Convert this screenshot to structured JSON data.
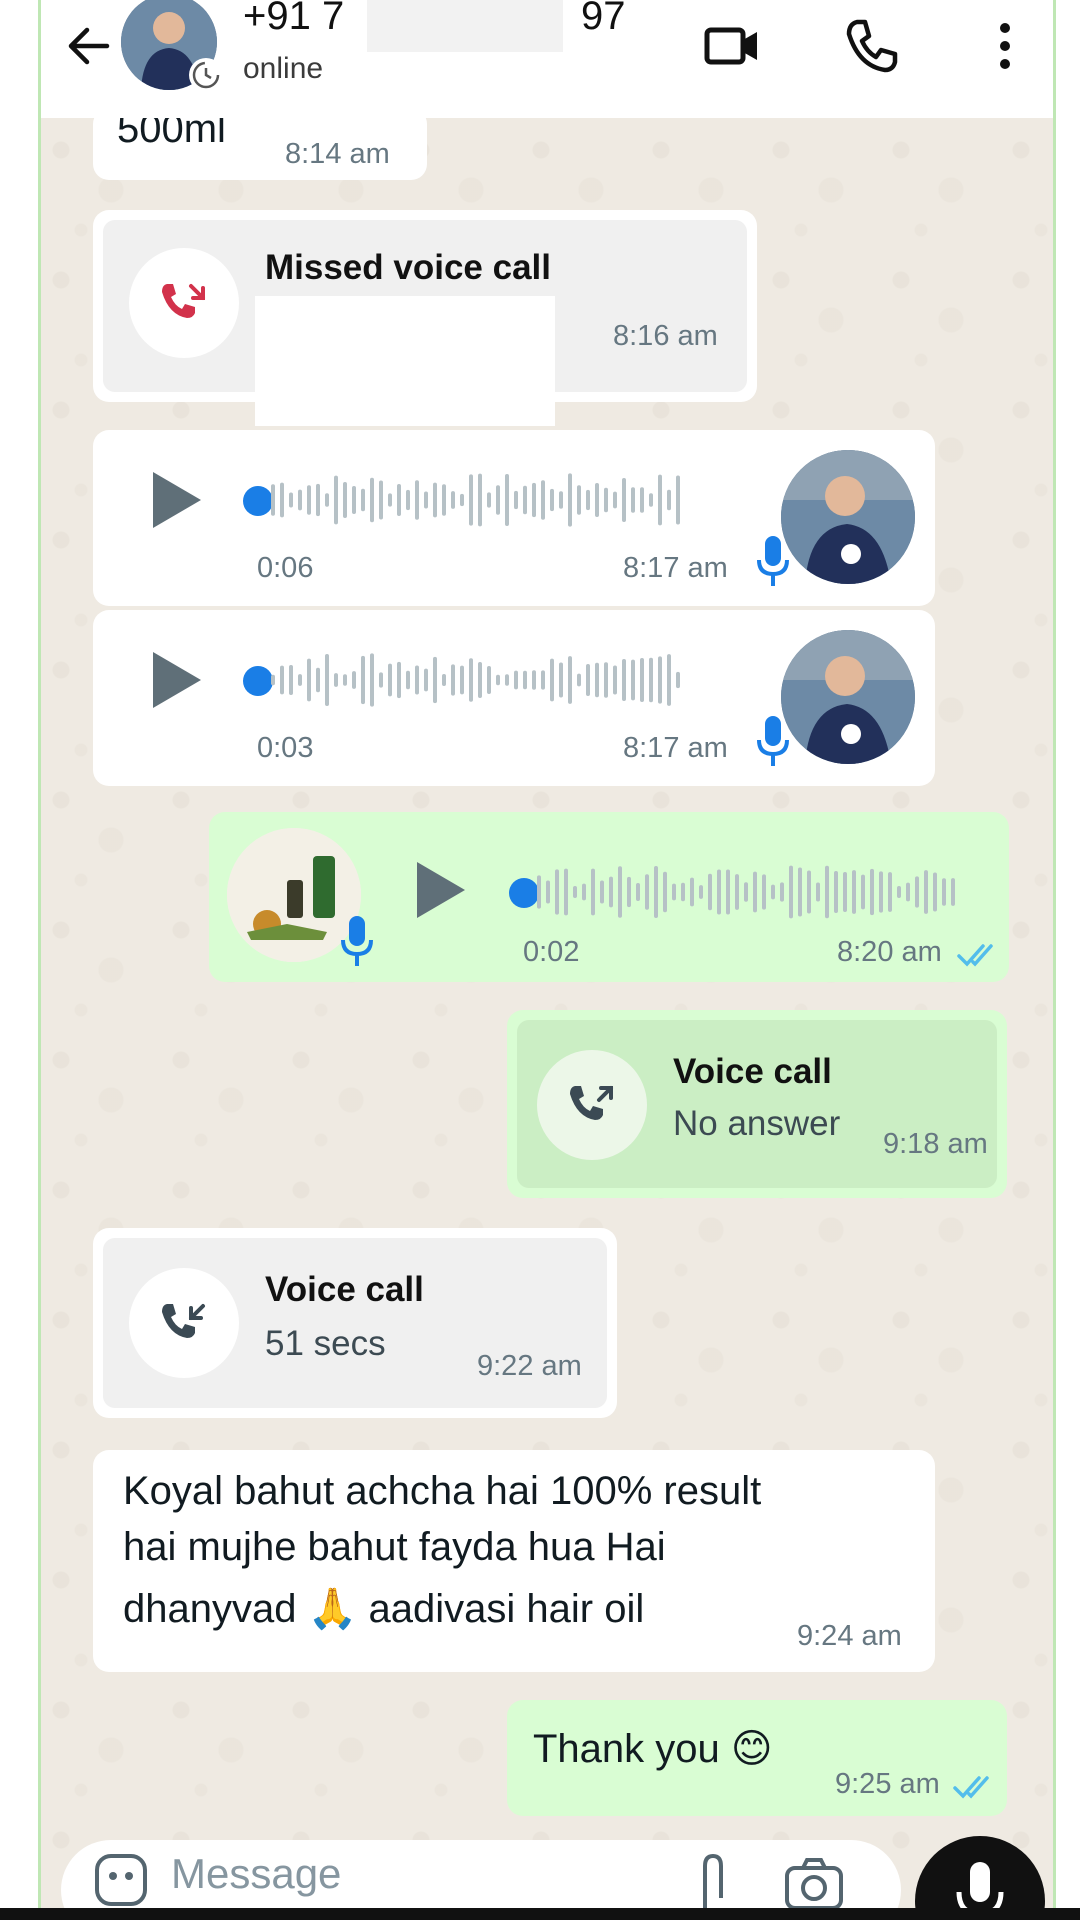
{
  "header": {
    "contact_prefix": "+91 7",
    "contact_suffix": "97",
    "status": "online",
    "icons": [
      "back-arrow-icon",
      "video-call-icon",
      "voice-call-icon",
      "more-options-icon"
    ]
  },
  "messages": [
    {
      "kind": "text_in_partial",
      "text": "500ml",
      "time": "8:14 am"
    },
    {
      "kind": "missed_call_in",
      "title": "Missed voice call",
      "time": "8:16 am",
      "icon": "missed-call-icon"
    },
    {
      "kind": "voice_in",
      "duration": "0:06",
      "time": "8:17 am",
      "played_fraction": 0.0
    },
    {
      "kind": "voice_in",
      "duration": "0:03",
      "time": "8:17 am",
      "played_fraction": 0.0
    },
    {
      "kind": "voice_out",
      "duration": "0:02",
      "time": "8:20 am",
      "status": "read"
    },
    {
      "kind": "call_out",
      "title": "Voice call",
      "subtitle": "No answer",
      "time": "9:18 am",
      "icon": "outgoing-call-icon"
    },
    {
      "kind": "call_in",
      "title": "Voice call",
      "subtitle": "51 secs",
      "time": "9:22 am",
      "icon": "incoming-call-icon"
    },
    {
      "kind": "text_in",
      "lines": [
        "Koyal bahut achcha hai 100% result",
        "hai mujhe bahut fayda hua Hai",
        "dhanyvad 🙏 aadivasi hair oil"
      ],
      "time": "9:24 am"
    },
    {
      "kind": "text_out",
      "text": "Thank you 😊",
      "time": "9:25 am",
      "status": "read"
    }
  ],
  "composer": {
    "placeholder": "Message"
  },
  "colors": {
    "incoming": "#ffffff",
    "outgoing": "#d9fdd3",
    "tick_read": "#53bdeb",
    "wave_dot": "#1a7ee6",
    "missed": "#d2324b"
  }
}
